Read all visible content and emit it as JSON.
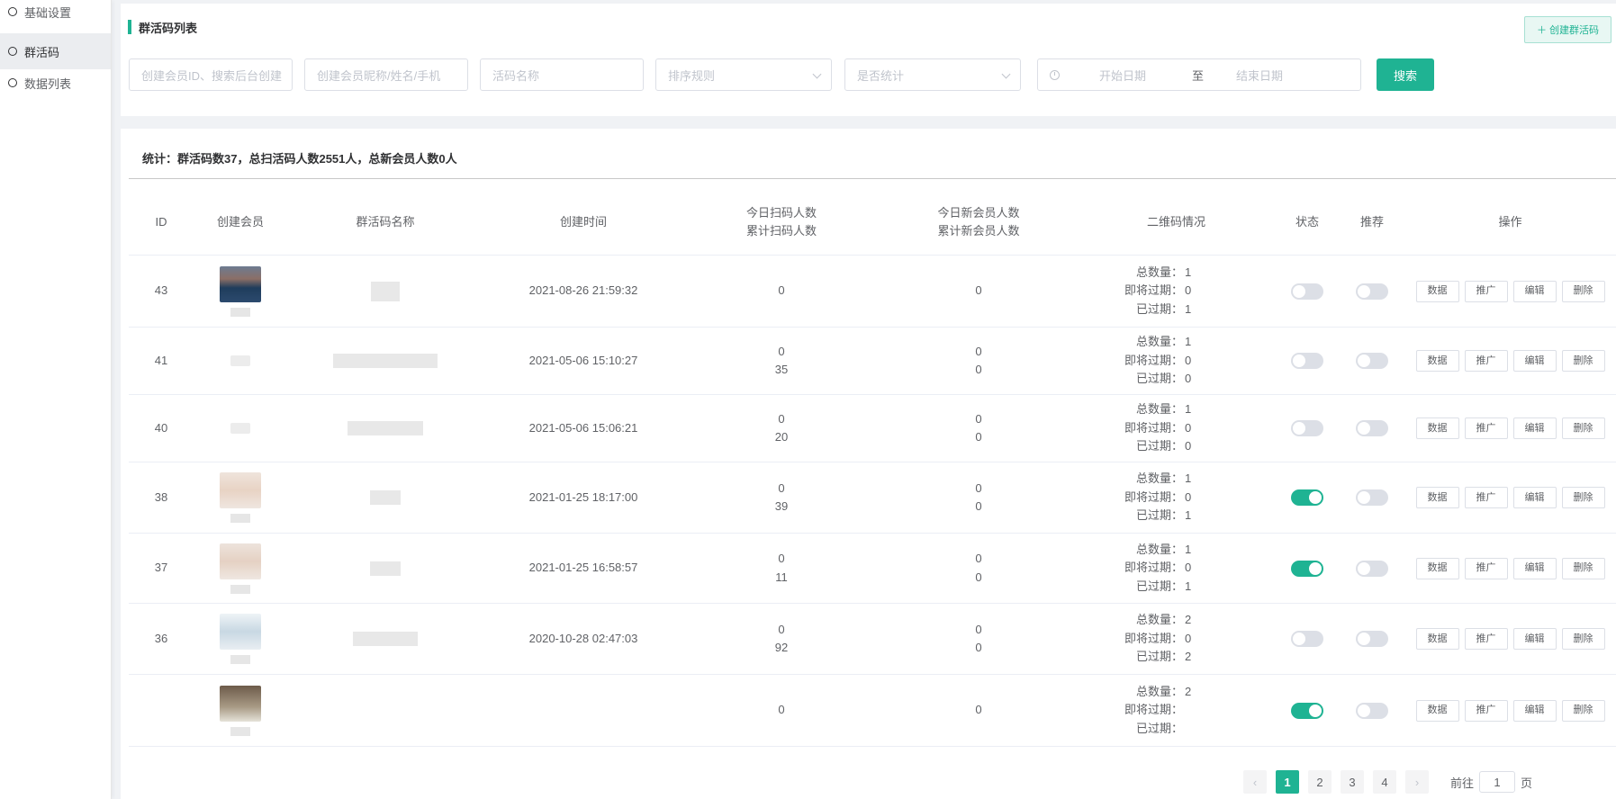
{
  "sidebar": {
    "items": [
      {
        "label": "基础设置"
      },
      {
        "label": "群活码"
      },
      {
        "label": "数据列表"
      }
    ]
  },
  "header": {
    "title": "群活码列表",
    "create_button": "＋ 创建群活码"
  },
  "filters": {
    "member_id_placeholder": "创建会员ID、搜索后台创建",
    "member_name_placeholder": "创建会员昵称/姓名/手机",
    "code_name_placeholder": "活码名称",
    "sort_placeholder": "排序规则",
    "stat_placeholder": "是否统计",
    "start_date_placeholder": "开始日期",
    "date_separator": "至",
    "end_date_placeholder": "结束日期",
    "search_button": "搜索"
  },
  "stats": "统计：群活码数37，总扫活码人数2551人，总新会员人数0人",
  "table": {
    "columns": {
      "id": "ID",
      "member": "创建会员",
      "name": "群活码名称",
      "created": "创建时间",
      "scan_today": "今日扫码人数",
      "scan_total": "累计扫码人数",
      "new_today": "今日新会员人数",
      "new_total": "累计新会员人数",
      "qr": "二维码情况",
      "status": "状态",
      "recommend": "推荐",
      "actions": "操作"
    },
    "labels": {
      "qr_total": "总数量：",
      "qr_expiring": "即将过期：",
      "qr_expired": "已过期："
    },
    "actions": [
      "数据",
      "推广",
      "编辑",
      "删除"
    ],
    "rows": [
      {
        "id": "43",
        "created": "2021-08-26 21:59:32",
        "scan_today": "0",
        "scan_total": "",
        "new_today": "0",
        "new_total": "",
        "qr_total": "1",
        "qr_expiring": "0",
        "qr_expired": "1",
        "status_on": false,
        "recommend_on": false
      },
      {
        "id": "41",
        "created": "2021-05-06 15:10:27",
        "scan_today": "0",
        "scan_total": "35",
        "new_today": "0",
        "new_total": "0",
        "qr_total": "1",
        "qr_expiring": "0",
        "qr_expired": "0",
        "status_on": false,
        "recommend_on": false
      },
      {
        "id": "40",
        "created": "2021-05-06 15:06:21",
        "scan_today": "0",
        "scan_total": "20",
        "new_today": "0",
        "new_total": "0",
        "qr_total": "1",
        "qr_expiring": "0",
        "qr_expired": "0",
        "status_on": false,
        "recommend_on": false
      },
      {
        "id": "38",
        "created": "2021-01-25 18:17:00",
        "scan_today": "0",
        "scan_total": "39",
        "new_today": "0",
        "new_total": "0",
        "qr_total": "1",
        "qr_expiring": "0",
        "qr_expired": "1",
        "status_on": true,
        "recommend_on": false
      },
      {
        "id": "37",
        "created": "2021-01-25 16:58:57",
        "scan_today": "0",
        "scan_total": "11",
        "new_today": "0",
        "new_total": "0",
        "qr_total": "1",
        "qr_expiring": "0",
        "qr_expired": "1",
        "status_on": true,
        "recommend_on": false
      },
      {
        "id": "36",
        "created": "2020-10-28 02:47:03",
        "scan_today": "0",
        "scan_total": "92",
        "new_today": "0",
        "new_total": "0",
        "qr_total": "2",
        "qr_expiring": "0",
        "qr_expired": "2",
        "status_on": false,
        "recommend_on": false
      },
      {
        "id": "",
        "created": "",
        "scan_today": "0",
        "scan_total": "",
        "new_today": "0",
        "new_total": "",
        "qr_total": "2",
        "qr_expiring": "",
        "qr_expired": "",
        "status_on": true,
        "recommend_on": false
      }
    ]
  },
  "pagination": {
    "prev_icon": "chevron-left-icon",
    "pages": [
      "1",
      "2",
      "3",
      "4"
    ],
    "current": "1",
    "next_icon": "chevron-right-icon",
    "goto_prefix": "前往",
    "goto_value": "1",
    "goto_suffix": "页"
  },
  "colors": {
    "accent": "#1fb393",
    "text": "#606266",
    "border": "#dcdfe6",
    "background": "#f0f2f5"
  }
}
